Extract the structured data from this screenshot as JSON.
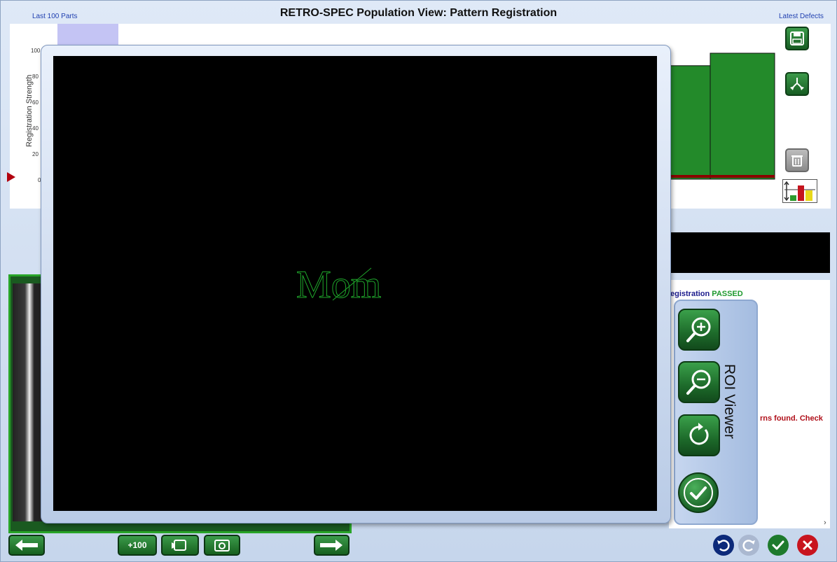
{
  "window": {
    "title": "RETRO-SPEC Population View:  Pattern Registration"
  },
  "chart": {
    "left_label": "Last 100 Parts",
    "right_label": "Latest Defects",
    "y_axis_title": "Registration Strength",
    "y_ticks": [
      "100",
      "80",
      "60",
      "40",
      "20",
      "0"
    ]
  },
  "chart_data": {
    "type": "bar",
    "categories": [
      "",
      ""
    ],
    "values": [
      100,
      111
    ],
    "xlabel": "",
    "ylabel": "Registration Strength",
    "ylim": [
      0,
      111
    ],
    "colors": {
      "bar": "#238a2a",
      "threshold": "#8a0000"
    }
  },
  "status": {
    "line1_prefix": "egistration ",
    "line1_result": "PASSED",
    "line2": "\\.",
    "line3": "rns found.  Check"
  },
  "roi_viewer": {
    "title": "ROI Viewer",
    "overlay_text": "Mom",
    "colors": {
      "outline": "#1fa62b",
      "background": "#000000"
    }
  },
  "bottom_bar": {
    "plus100_label": "+100"
  },
  "icons": {
    "save": "floppy-disk-icon",
    "merge": "merge-arrows-icon",
    "trash": "trash-icon",
    "chart_scale": "bar-chart-scale-icon",
    "zoom_in": "zoom-in-icon",
    "zoom_out": "zoom-out-icon",
    "rotate": "rotate-icon",
    "accept": "checkmark-icon",
    "prev": "arrow-left-icon",
    "next": "arrow-right-icon",
    "camera_mode": "camera-icon",
    "snapshot": "snapshot-icon",
    "undo": "undo-icon",
    "redo": "redo-icon",
    "ok": "check-circle-icon",
    "cancel": "close-circle-icon"
  }
}
